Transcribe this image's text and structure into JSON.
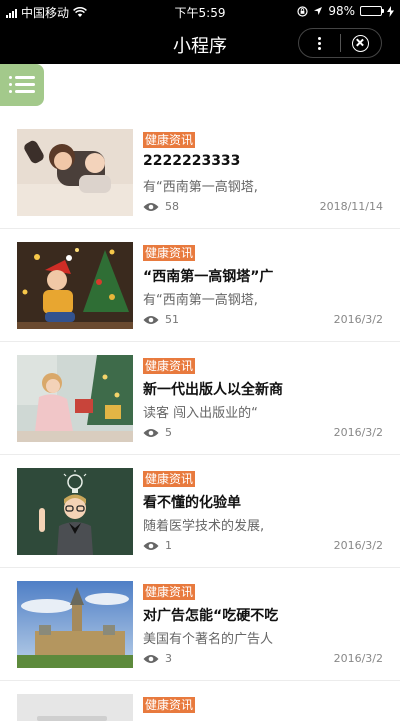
{
  "status_bar": {
    "carrier": "中国移动",
    "time": "下午5:59",
    "battery": "98%",
    "battery_level": 0.98
  },
  "nav": {
    "title": "小程序"
  },
  "category_color": "#e87a3e",
  "menu_color": "#a3c98b",
  "articles": [
    {
      "tag": "健康资讯",
      "title": "2222223333",
      "summary": "有“西南第一高钢塔,",
      "views": "58",
      "date": "2018/11/14",
      "thumbnail": "kids-on-rug"
    },
    {
      "tag": "健康资讯",
      "title": "“西南第一高钢塔”广",
      "summary": "有“西南第一高钢塔,",
      "views": "51",
      "date": "2016/3/2",
      "thumbnail": "child-christmas-tree"
    },
    {
      "tag": "健康资讯",
      "title": "新一代出版人以全新商",
      "summary": "读客 闯入出版业的“",
      "views": "5",
      "date": "2016/3/2",
      "thumbnail": "girl-with-gifts"
    },
    {
      "tag": "健康资讯",
      "title": "看不懂的化验单",
      "summary": "随着医学技术的发展,",
      "views": "1",
      "date": "2016/3/2",
      "thumbnail": "boy-lightbulb-chalkboard"
    },
    {
      "tag": "健康资讯",
      "title": "对广告怎能“吃硬不吃",
      "summary": "美国有个著名的广告人",
      "views": "3",
      "date": "2016/3/2",
      "thumbnail": "parliament-building"
    },
    {
      "tag": "健康资讯",
      "thumbnail": "partial"
    }
  ]
}
